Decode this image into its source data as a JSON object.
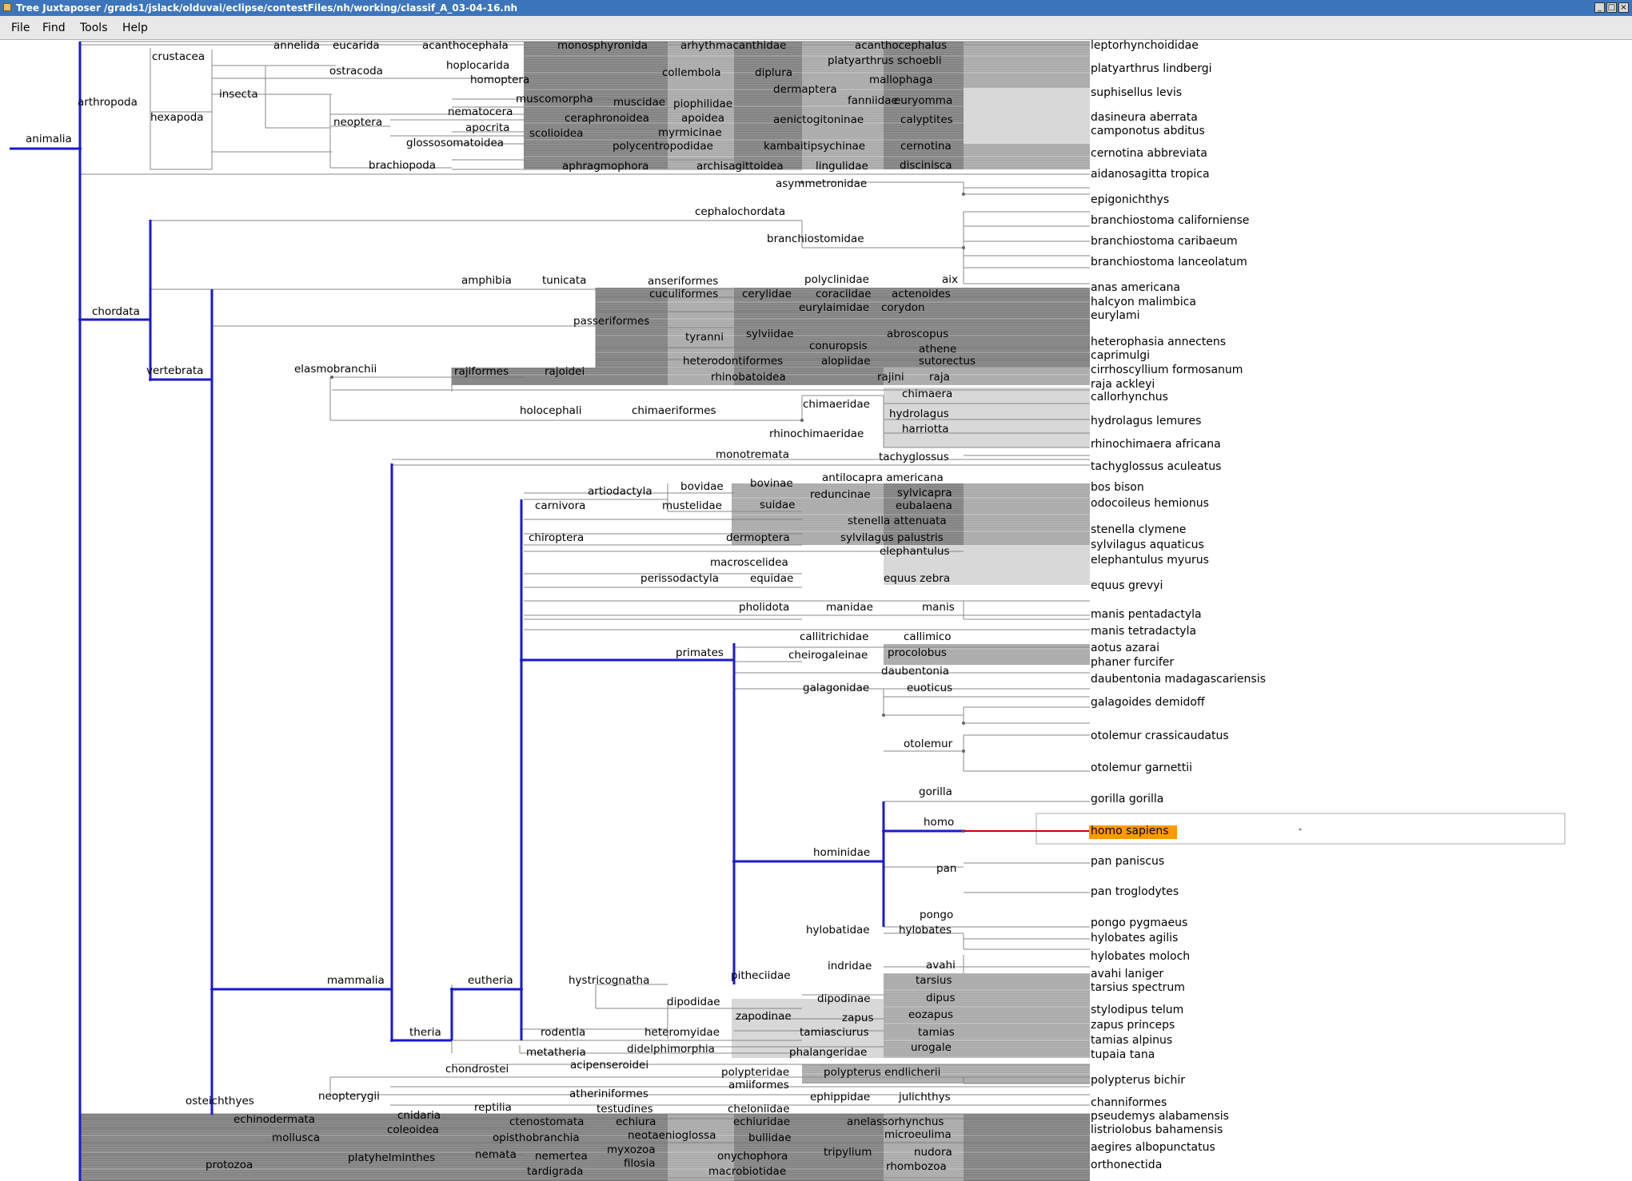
{
  "window": {
    "title": "Tree Juxtaposer /grads1/jslack/olduvai/eclipse/contestFiles/nh/working/classif_A_03-04-16.nh",
    "controls": [
      "_",
      "□",
      "×"
    ]
  },
  "menu": [
    "File",
    "Find",
    "Tools",
    "Help"
  ],
  "colors": {
    "blue_path": "#1a1acd",
    "highlight": "#ff9900",
    "highlight_edge": "#cc0000",
    "line": "#888888",
    "dense_dark": "#808080",
    "dense_mid": "#a9a9a9",
    "dense_light": "#d8d8d8"
  },
  "tree": {
    "root": "animalia",
    "selected_leaf": "homo sapiens",
    "labels": [
      {
        "t": "animalia",
        "id": "animalia"
      },
      {
        "t": "arthropoda",
        "id": "arthropoda"
      },
      {
        "t": "crustacea",
        "id": "crustacea"
      },
      {
        "t": "hexapoda",
        "id": "hexapoda"
      },
      {
        "t": "insecta",
        "id": "insecta"
      },
      {
        "t": "annelida",
        "id": "annelida"
      },
      {
        "t": "eucarida",
        "id": "eucarida"
      },
      {
        "t": "acanthocephala",
        "id": "acanthocephala"
      },
      {
        "t": "monosphyronida",
        "id": "monosphyronida"
      },
      {
        "t": "arhythmacanthidae",
        "id": "arhythmacanthidae"
      },
      {
        "t": "acanthocephalus",
        "id": "acanthocephalus"
      },
      {
        "t": "hoplocarida",
        "id": "hoplocarida"
      },
      {
        "t": "ostracoda",
        "id": "ostracoda"
      },
      {
        "t": "homoptera",
        "id": "homoptera"
      },
      {
        "t": "collembola",
        "id": "collembola"
      },
      {
        "t": "diplura",
        "id": "diplura"
      },
      {
        "t": "platyarthrus schoebli",
        "id": "platyarthrus-schoebli"
      },
      {
        "t": "mallophaga",
        "id": "mallophaga"
      },
      {
        "t": "dermaptera",
        "id": "dermaptera-1"
      },
      {
        "t": "muscomorpha",
        "id": "muscomorpha"
      },
      {
        "t": "muscidae",
        "id": "muscidae"
      },
      {
        "t": "piophilidae",
        "id": "piophilidae"
      },
      {
        "t": "fanniidae",
        "id": "fanniidae"
      },
      {
        "t": "euryomma",
        "id": "euryomma"
      },
      {
        "t": "neoptera",
        "id": "neoptera"
      },
      {
        "t": "nematocera",
        "id": "nematocera"
      },
      {
        "t": "ceraphronoidea",
        "id": "ceraphronoidea"
      },
      {
        "t": "apoidea",
        "id": "apoidea"
      },
      {
        "t": "aenictogitoninae",
        "id": "aenictogitoninae"
      },
      {
        "t": "calyptites",
        "id": "calyptites"
      },
      {
        "t": "apocrita",
        "id": "apocrita"
      },
      {
        "t": "scolioidea",
        "id": "scolioidea"
      },
      {
        "t": "myrmicinae",
        "id": "myrmicinae"
      },
      {
        "t": "glossosomatoidea",
        "id": "glossosomatoidea"
      },
      {
        "t": "polycentropodidae",
        "id": "polycentropodidae"
      },
      {
        "t": "kambaitipsychinae",
        "id": "kambaitipsychinae"
      },
      {
        "t": "cernotina",
        "id": "cernotina"
      },
      {
        "t": "brachiopoda",
        "id": "brachiopoda"
      },
      {
        "t": "aphragmophora",
        "id": "aphragmophora"
      },
      {
        "t": "archisagittoidea",
        "id": "archisagittoidea"
      },
      {
        "t": "lingulidae",
        "id": "lingulidae"
      },
      {
        "t": "discinisca",
        "id": "discinisca"
      },
      {
        "t": "asymmetronidae",
        "id": "asymmetronidae"
      },
      {
        "t": "cephalochordata",
        "id": "cephalochordata"
      },
      {
        "t": "branchiostomidae",
        "id": "branchiostomidae"
      },
      {
        "t": "chordata",
        "id": "chordata"
      },
      {
        "t": "vertebrata",
        "id": "vertebrata"
      },
      {
        "t": "amphibia",
        "id": "amphibia"
      },
      {
        "t": "tunicata",
        "id": "tunicata"
      },
      {
        "t": "anseriformes",
        "id": "anseriformes"
      },
      {
        "t": "polyclinidae",
        "id": "polyclinidae"
      },
      {
        "t": "aix",
        "id": "aix"
      },
      {
        "t": "cuculiformes",
        "id": "cuculiformes"
      },
      {
        "t": "cerylidae",
        "id": "cerylidae"
      },
      {
        "t": "coraciidae",
        "id": "coraciidae"
      },
      {
        "t": "actenoides",
        "id": "actenoides"
      },
      {
        "t": "eurylaimidae",
        "id": "eurylaimidae"
      },
      {
        "t": "corydon",
        "id": "corydon"
      },
      {
        "t": "passeriformes",
        "id": "passeriformes"
      },
      {
        "t": "tyranni",
        "id": "tyranni"
      },
      {
        "t": "sylviidae",
        "id": "sylviidae"
      },
      {
        "t": "abroscopus",
        "id": "abroscopus"
      },
      {
        "t": "conuropsis",
        "id": "conuropsis"
      },
      {
        "t": "athene",
        "id": "athene"
      },
      {
        "t": "heterodontiformes",
        "id": "heterodontiformes"
      },
      {
        "t": "alopiidae",
        "id": "alopiidae"
      },
      {
        "t": "sutorectus",
        "id": "sutorectus"
      },
      {
        "t": "elasmobranchii",
        "id": "elasmobranchii"
      },
      {
        "t": "rajiformes",
        "id": "rajiformes"
      },
      {
        "t": "rajoidei",
        "id": "rajoidei"
      },
      {
        "t": "rhinobatoidea",
        "id": "rhinobatoidea"
      },
      {
        "t": "rajini",
        "id": "rajini"
      },
      {
        "t": "raja",
        "id": "raja"
      },
      {
        "t": "chimaera",
        "id": "chimaera"
      },
      {
        "t": "chimaeridae",
        "id": "chimaeridae"
      },
      {
        "t": "holocephali",
        "id": "holocephali"
      },
      {
        "t": "chimaeriformes",
        "id": "chimaeriformes"
      },
      {
        "t": "hydrolagus",
        "id": "hydrolagus"
      },
      {
        "t": "rhinochimaeridae",
        "id": "rhinochimaeridae"
      },
      {
        "t": "harriotta",
        "id": "harriotta"
      },
      {
        "t": "monotremata",
        "id": "monotremata"
      },
      {
        "t": "tachyglossus",
        "id": "tachyglossus"
      },
      {
        "t": "antilocapra americana",
        "id": "antilocapra-americana"
      },
      {
        "t": "bovinae",
        "id": "bovinae"
      },
      {
        "t": "artiodactyla",
        "id": "artiodactyla"
      },
      {
        "t": "bovidae",
        "id": "bovidae"
      },
      {
        "t": "reduncinae",
        "id": "reduncinae"
      },
      {
        "t": "sylvicapra",
        "id": "sylvicapra"
      },
      {
        "t": "carnivora",
        "id": "carnivora"
      },
      {
        "t": "mustelidae",
        "id": "mustelidae"
      },
      {
        "t": "suidae",
        "id": "suidae"
      },
      {
        "t": "eubalaena",
        "id": "eubalaena"
      },
      {
        "t": "stenella attenuata",
        "id": "stenella-attenuata"
      },
      {
        "t": "chiroptera",
        "id": "chiroptera"
      },
      {
        "t": "dermoptera",
        "id": "dermoptera"
      },
      {
        "t": "sylvilagus palustris",
        "id": "sylvilagus-palustris"
      },
      {
        "t": "elephantulus",
        "id": "elephantulus"
      },
      {
        "t": "macroscelidea",
        "id": "macroscelidea"
      },
      {
        "t": "perissodactyla",
        "id": "perissodactyla"
      },
      {
        "t": "equidae",
        "id": "equidae"
      },
      {
        "t": "equus zebra",
        "id": "equus-zebra"
      },
      {
        "t": "pholidota",
        "id": "pholidota"
      },
      {
        "t": "manidae",
        "id": "manidae"
      },
      {
        "t": "manis",
        "id": "manis"
      },
      {
        "t": "callitrichidae",
        "id": "callitrichidae"
      },
      {
        "t": "callimico",
        "id": "callimico"
      },
      {
        "t": "primates",
        "id": "primates"
      },
      {
        "t": "cheirogaleinae",
        "id": "cheirogaleinae"
      },
      {
        "t": "procolobus",
        "id": "procolobus"
      },
      {
        "t": "daubentonia",
        "id": "daubentonia"
      },
      {
        "t": "galagonidae",
        "id": "galagonidae"
      },
      {
        "t": "euoticus",
        "id": "euoticus"
      },
      {
        "t": "otolemur",
        "id": "otolemur"
      },
      {
        "t": "gorilla",
        "id": "gorilla"
      },
      {
        "t": "homo",
        "id": "homo"
      },
      {
        "t": "hominidae",
        "id": "hominidae"
      },
      {
        "t": "pan",
        "id": "pan"
      },
      {
        "t": "pongo",
        "id": "pongo"
      },
      {
        "t": "hylobatidae",
        "id": "hylobatidae"
      },
      {
        "t": "hylobates",
        "id": "hylobates"
      },
      {
        "t": "indridae",
        "id": "indridae"
      },
      {
        "t": "avahi",
        "id": "avahi"
      },
      {
        "t": "mammalia",
        "id": "mammalia"
      },
      {
        "t": "eutheria",
        "id": "eutheria"
      },
      {
        "t": "hystricognatha",
        "id": "hystricognatha"
      },
      {
        "t": "pitheciidae",
        "id": "pitheciidae"
      },
      {
        "t": "tarsius",
        "id": "tarsius"
      },
      {
        "t": "dipodidae",
        "id": "dipodidae"
      },
      {
        "t": "dipodinae",
        "id": "dipodinae"
      },
      {
        "t": "dipus",
        "id": "dipus"
      },
      {
        "t": "zapodinae",
        "id": "zapodinae"
      },
      {
        "t": "zapus",
        "id": "zapus"
      },
      {
        "t": "eozapus",
        "id": "eozapus"
      },
      {
        "t": "theria",
        "id": "theria"
      },
      {
        "t": "rodentia",
        "id": "rodentia"
      },
      {
        "t": "heteromyidae",
        "id": "heteromyidae"
      },
      {
        "t": "tamiasciurus",
        "id": "tamiasciurus"
      },
      {
        "t": "tamias",
        "id": "tamias"
      },
      {
        "t": "metatheria",
        "id": "metatheria"
      },
      {
        "t": "didelphimorphia",
        "id": "didelphimorphia"
      },
      {
        "t": "phalangeridae",
        "id": "phalangeridae"
      },
      {
        "t": "urogale",
        "id": "urogale"
      },
      {
        "t": "chondrostei",
        "id": "chondrostei"
      },
      {
        "t": "acipenseroidei",
        "id": "acipenseroidei"
      },
      {
        "t": "polypteridae",
        "id": "polypteridae"
      },
      {
        "t": "polypterus endlicherii",
        "id": "polypterus-endlicherii"
      },
      {
        "t": "amiiformes",
        "id": "amiiformes"
      },
      {
        "t": "osteichthyes",
        "id": "osteichthyes"
      },
      {
        "t": "neopterygii",
        "id": "neopterygii"
      },
      {
        "t": "atheriniformes",
        "id": "atheriniformes"
      },
      {
        "t": "ephippidae",
        "id": "ephippidae"
      },
      {
        "t": "julichthys",
        "id": "julichthys"
      },
      {
        "t": "reptilia",
        "id": "reptilia"
      },
      {
        "t": "testudines",
        "id": "testudines"
      },
      {
        "t": "cheloniidae",
        "id": "cheloniidae"
      },
      {
        "t": "echinodermata",
        "id": "echinodermata"
      },
      {
        "t": "cnidaria",
        "id": "cnidaria"
      },
      {
        "t": "ctenostomata",
        "id": "ctenostomata"
      },
      {
        "t": "echiura",
        "id": "echiura"
      },
      {
        "t": "echiuridae",
        "id": "echiuridae"
      },
      {
        "t": "anelassorhynchus",
        "id": "anelassorhynchus"
      },
      {
        "t": "coleoidea",
        "id": "coleoidea"
      },
      {
        "t": "mollusca",
        "id": "mollusca"
      },
      {
        "t": "opisthobranchia",
        "id": "opisthobranchia"
      },
      {
        "t": "neotaenioglossa",
        "id": "neotaenioglossa"
      },
      {
        "t": "bullidae",
        "id": "bullidae"
      },
      {
        "t": "microeulima",
        "id": "microeulima"
      },
      {
        "t": "platyhelminthes",
        "id": "platyhelminthes"
      },
      {
        "t": "myxozoa",
        "id": "myxozoa"
      },
      {
        "t": "nemata",
        "id": "nemata"
      },
      {
        "t": "nemertea",
        "id": "nemertea"
      },
      {
        "t": "onychophora",
        "id": "onychophora"
      },
      {
        "t": "tripylium",
        "id": "tripylium"
      },
      {
        "t": "nudora",
        "id": "nudora"
      },
      {
        "t": "protozoa",
        "id": "protozoa"
      },
      {
        "t": "filosia",
        "id": "filosia"
      },
      {
        "t": "tardigrada",
        "id": "tardigrada"
      },
      {
        "t": "macrobiotidae",
        "id": "macrobiotidae"
      },
      {
        "t": "rhombozoa",
        "id": "rhombozoa"
      }
    ],
    "leaves": [
      "leptorhynchoididae",
      "platyarthrus lindbergi",
      "suphisellus levis",
      "dasineura aberrata",
      "camponotus abditus",
      "cernotina abbreviata",
      "aidanosagitta tropica",
      "epigonichthys",
      "branchiostoma californiense",
      "branchiostoma caribaeum",
      "branchiostoma lanceolatum",
      "anas americana",
      "halcyon malimbica",
      "eurylami",
      "heterophasia annectens",
      "caprimulgi",
      "cirrhoscyllium formosanum",
      "raja ackleyi",
      "callorhynchus",
      "hydrolagus lemures",
      "rhinochimaera africana",
      "tachyglossus aculeatus",
      "bos bison",
      "odocoileus hemionus",
      "stenella clymene",
      "sylvilagus aquaticus",
      "elephantulus myurus",
      "equus grevyi",
      "manis pentadactyla",
      "manis tetradactyla",
      "aotus azarai",
      "phaner furcifer",
      "daubentonia madagascariensis",
      "galagoides demidoff",
      "otolemur crassicaudatus",
      "otolemur garnettii",
      "gorilla gorilla",
      "homo sapiens",
      "pan paniscus",
      "pan troglodytes",
      "pongo pygmaeus",
      "hylobates agilis",
      "hylobates moloch",
      "avahi laniger",
      "tarsius spectrum",
      "stylodipus telum",
      "zapus princeps",
      "tamias alpinus",
      "tupaia tana",
      "polypterus bichir",
      "channiformes",
      "pseudemys alabamensis",
      "listriolobus bahamensis",
      "aegires albopunctatus",
      "orthonectida"
    ]
  }
}
